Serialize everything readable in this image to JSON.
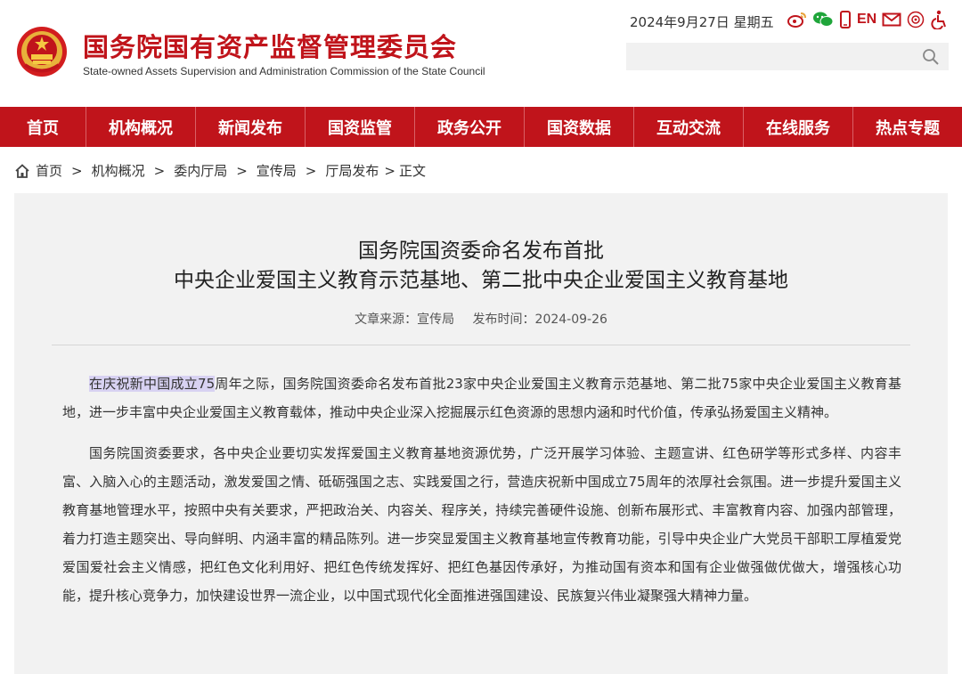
{
  "header": {
    "site_title": "国务院国有资产监督管理委员会",
    "site_subtitle": "State-owned Assets Supervision and Administration Commission of the State Council",
    "date_text": "2024年9月27日 星期五",
    "en_label": "EN",
    "search": {
      "placeholder": "",
      "value": ""
    }
  },
  "nav": {
    "items": [
      "首页",
      "机构概况",
      "新闻发布",
      "国资监管",
      "政务公开",
      "国资数据",
      "互动交流",
      "在线服务",
      "热点专题"
    ]
  },
  "breadcrumb": {
    "items": [
      "首页",
      "机构概况",
      "委内厅局",
      "宣传局",
      "厅局发布"
    ],
    "current": "正文",
    "separator": ">"
  },
  "article": {
    "title_line1": "国务院国资委命名发布首批",
    "title_line2": "中央企业爱国主义教育示范基地、第二批中央企业爱国主义教育基地",
    "source": "文章来源：宣传局",
    "publish_time": "发布时间：2024-09-26",
    "p1_highlight": "在庆祝新中国成立75",
    "p1_rest": "周年之际，国务院国资委命名发布首批23家中央企业爱国主义教育示范基地、第二批75家中央企业爱国主义教育基地，进一步丰富中央企业爱国主义教育载体，推动中央企业深入挖掘展示红色资源的思想内涵和时代价值，传承弘扬爱国主义精神。",
    "p2": "国务院国资委要求，各中央企业要切实发挥爱国主义教育基地资源优势，广泛开展学习体验、主题宣讲、红色研学等形式多样、内容丰富、入脑入心的主题活动，激发爱国之情、砥砺强国之志、实践爱国之行，营造庆祝新中国成立75周年的浓厚社会氛围。进一步提升爱国主义教育基地管理水平，按照中央有关要求，严把政治关、内容关、程序关，持续完善硬件设施、创新布展形式、丰富教育内容、加强内部管理，着力打造主题突出、导向鲜明、内涵丰富的精品陈列。进一步突显爱国主义教育基地宣传教育功能，引导中央企业广大党员干部职工厚植爱党爱国爱社会主义情感，把红色文化利用好、把红色传统发挥好、把红色基因传承好，为推动国有资本和国有企业做强做优做大，增强核心功能，提升核心竞争力，加快建设世界一流企业，以中国式现代化全面推进强国建设、民族复兴伟业凝聚强大精神力量。"
  },
  "colors": {
    "brand_red": "#c0141b",
    "panel_bg": "#f2f2f2",
    "highlight": "#d8d2f2"
  },
  "icons": [
    "national-emblem-icon",
    "weibo-icon",
    "wechat-icon",
    "mobile-icon",
    "mail-icon",
    "elder-care-icon",
    "accessibility-icon",
    "search-icon",
    "home-icon"
  ]
}
